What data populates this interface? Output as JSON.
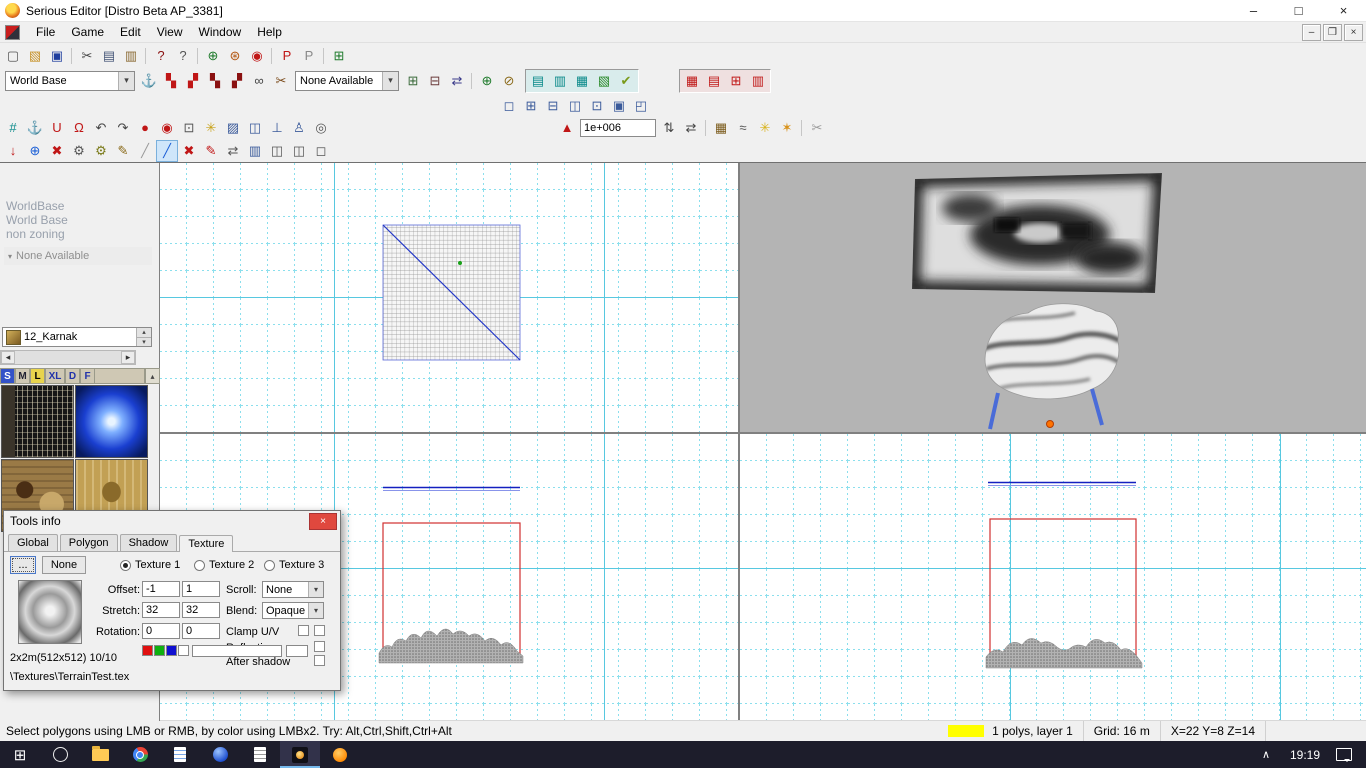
{
  "window": {
    "title": "Serious Editor [Distro Beta AP_3381]"
  },
  "glyphs": {
    "minimize": "–",
    "maximize": "□",
    "close": "×",
    "mdi_minimize": "–",
    "mdi_restore": "❐",
    "mdi_close": "×",
    "combo_arrow": "▾",
    "spin_up": "▴",
    "spin_down": "▾",
    "scroll_left": "◂",
    "scroll_right": "▸",
    "panel_collapse": "▴",
    "lp_chevron": "▾",
    "start": "⊞",
    "tray_chevron": "∧",
    "dialog_close": "×",
    "browse": "..."
  },
  "menu": {
    "items": [
      "File",
      "Game",
      "Edit",
      "View",
      "Window",
      "Help"
    ]
  },
  "toolbars": {
    "world_combo": "World Base",
    "none_combo": "None Available",
    "terrain_size_value": "1e+006",
    "row1": [
      {
        "n": "new-file-icon",
        "g": "▢",
        "c": "#555555"
      },
      {
        "n": "open-folder-icon",
        "g": "▧",
        "c": "#c8932a"
      },
      {
        "n": "save-icon",
        "g": "▣",
        "c": "#1f3e9e"
      },
      {
        "sep": true
      },
      {
        "n": "cut-icon",
        "g": "✂",
        "c": "#444444"
      },
      {
        "n": "copy-icon",
        "g": "▤",
        "c": "#445577"
      },
      {
        "n": "paste-icon",
        "g": "▥",
        "c": "#8a6a33"
      },
      {
        "sep": true
      },
      {
        "n": "help-icon",
        "g": "?",
        "c": "#8a1111"
      },
      {
        "n": "context-help-icon",
        "g": "?",
        "c": "#555555"
      },
      {
        "sep": true
      },
      {
        "n": "world-globe-icon",
        "g": "⊕",
        "c": "#1d7a2a"
      },
      {
        "n": "world-textures-icon",
        "g": "⊛",
        "c": "#b35712"
      },
      {
        "n": "world-red-icon",
        "g": "◉",
        "c": "#c01616"
      },
      {
        "sep": true
      },
      {
        "n": "p-red-icon",
        "g": "P",
        "c": "#c01616"
      },
      {
        "n": "p-gray-icon",
        "g": "P",
        "c": "#8a8a8a"
      },
      {
        "sep": true
      },
      {
        "n": "table-green-icon",
        "g": "⊞",
        "c": "#1d7a2a"
      }
    ],
    "row2_icons_a": [
      {
        "n": "anchor-icon",
        "g": "⚓",
        "c": "#1f3e9e"
      },
      {
        "n": "texture-stamp-1-icon",
        "g": "▚",
        "c": "#c01616"
      },
      {
        "n": "texture-stamp-2-icon",
        "g": "▞",
        "c": "#c01616"
      },
      {
        "n": "texture-stamp-3-icon",
        "g": "▚",
        "c": "#8a1111"
      },
      {
        "n": "texture-stamp-4-icon",
        "g": "▞",
        "c": "#8a1111"
      },
      {
        "n": "link-texture-icon",
        "g": "∞",
        "c": "#444444"
      },
      {
        "n": "unlink-texture-icon",
        "g": "✂",
        "c": "#7a4a1a"
      }
    ],
    "row2_icons_b": [
      {
        "n": "entity-add-icon",
        "g": "⊞",
        "c": "#3a6a3a"
      },
      {
        "n": "entity-remove-icon",
        "g": "⊟",
        "c": "#6a3a3a"
      },
      {
        "n": "entity-swap-icon",
        "g": "⇄",
        "c": "#3a3a8a"
      }
    ],
    "row2_icons_c": [
      {
        "n": "csg-add-icon",
        "g": "⊕",
        "c": "#1d7a2a"
      },
      {
        "n": "csg-split-icon",
        "g": "⊘",
        "c": "#8a6a1a"
      }
    ],
    "row2_group_teal": [
      {
        "n": "layer-primitive-icon",
        "g": "▤",
        "c": "#0a8a8a"
      },
      {
        "n": "layer-conus-icon",
        "g": "▥",
        "c": "#0a8a8a"
      },
      {
        "n": "layer-torus-icon",
        "g": "▦",
        "c": "#0a8a8a"
      },
      {
        "n": "layer-terrain-icon",
        "g": "▧",
        "c": "#2a8a2a"
      },
      {
        "n": "layer-check-icon",
        "g": "✔",
        "c": "#7a9a1a"
      }
    ],
    "row2_group_red": [
      {
        "n": "portal-icon",
        "g": "▦",
        "c": "#c01616"
      },
      {
        "n": "occluder-icon",
        "g": "▤",
        "c": "#c01616"
      },
      {
        "n": "detail-icon",
        "g": "⊞",
        "c": "#c01616"
      },
      {
        "n": "field-icon",
        "g": "▥",
        "c": "#c01616"
      }
    ],
    "row3": [
      {
        "n": "viewport-single-icon",
        "g": "◻",
        "c": "#3a5a9a"
      },
      {
        "n": "viewport-quad-icon",
        "g": "⊞",
        "c": "#3a5a9a"
      },
      {
        "n": "viewport-horiz-icon",
        "g": "⊟",
        "c": "#3a5a9a"
      },
      {
        "n": "viewport-vert-icon",
        "g": "◫",
        "c": "#3a5a9a"
      },
      {
        "n": "viewport-three-icon",
        "g": "⊡",
        "c": "#3a5a9a"
      },
      {
        "n": "viewport-custom-icon",
        "g": "▣",
        "c": "#3a5a9a"
      },
      {
        "n": "viewport-full-icon",
        "g": "◰",
        "c": "#3a5a9a"
      }
    ],
    "row4_left": [
      {
        "n": "grid-toggle-icon",
        "g": "#",
        "c": "#0a8a8a"
      },
      {
        "n": "snap-anchor-icon",
        "g": "⚓",
        "c": "#555555"
      },
      {
        "n": "magnet-u-icon",
        "g": "U",
        "c": "#c01616"
      },
      {
        "n": "magnet-o-icon",
        "g": "Ω",
        "c": "#c01616"
      },
      {
        "n": "rotate-left-icon",
        "g": "↶",
        "c": "#444444"
      },
      {
        "n": "rotate-right-icon",
        "g": "↷",
        "c": "#444444"
      },
      {
        "n": "marker-red-icon",
        "g": "●",
        "c": "#c01616"
      },
      {
        "n": "marker-ring-icon",
        "g": "◉",
        "c": "#c01616"
      },
      {
        "n": "select-box-icon",
        "g": "⊡",
        "c": "#555555"
      },
      {
        "n": "light-icon",
        "g": "✳",
        "c": "#c8a21a"
      },
      {
        "n": "picture-icon",
        "g": "▨",
        "c": "#3a5a9a"
      },
      {
        "n": "window-icon",
        "g": "◫",
        "c": "#3a5a9a"
      },
      {
        "n": "ruler-icon",
        "g": "⊥",
        "c": "#3a5a9a"
      },
      {
        "n": "person-icon",
        "g": "♙",
        "c": "#3a5a9a"
      },
      {
        "n": "target-icon",
        "g": "◎",
        "c": "#555555"
      }
    ],
    "row4_mid_pre": [
      {
        "n": "terrain-brush-icon",
        "g": "▲",
        "c": "#c01616"
      }
    ],
    "row4_mid_spin": [
      {
        "n": "spin-up-down-icon",
        "g": "⇅",
        "c": "#444444"
      },
      {
        "n": "spin-swap-icon",
        "g": "⇄",
        "c": "#444444"
      }
    ],
    "row4_mid_post": [
      {
        "n": "terrain-edit-icon",
        "g": "▦",
        "c": "#7a5a1a"
      },
      {
        "n": "terrain-smooth-icon",
        "g": "≈",
        "c": "#555555"
      },
      {
        "n": "sun-icon",
        "g": "✳",
        "c": "#d8b21a"
      },
      {
        "n": "sun-alt-icon",
        "g": "✶",
        "c": "#d8921a"
      },
      {
        "sep": true
      },
      {
        "n": "cut-terrain-icon",
        "g": "✂",
        "c": "#9a9a9a"
      }
    ],
    "row5": [
      {
        "n": "drop-marker-icon",
        "g": "↓",
        "c": "#c01616"
      },
      {
        "n": "world-wire-icon",
        "g": "⊕",
        "c": "#1a5ed6"
      },
      {
        "n": "crush-icon",
        "g": "✖",
        "c": "#c01616"
      },
      {
        "n": "gears-icon",
        "g": "⚙",
        "c": "#555555"
      },
      {
        "n": "gear-add-icon",
        "g": "⚙",
        "c": "#7a7a1a"
      },
      {
        "n": "script-icon",
        "g": "✎",
        "c": "#8a6a1a"
      },
      {
        "n": "pencil-gray-icon",
        "g": "╱",
        "c": "#9a9a9a"
      },
      {
        "n": "pencil-active-icon",
        "g": "╱",
        "c": "#1a5ed6",
        "bg": "#cfe6fa",
        "bd": "#7ab0dc"
      },
      {
        "n": "erase-icon",
        "g": "✖",
        "c": "#c01616"
      },
      {
        "n": "brush-icon",
        "g": "✎",
        "c": "#c01616"
      },
      {
        "n": "flip-icon",
        "g": "⇄",
        "c": "#555555"
      },
      {
        "n": "book-icon",
        "g": "▥",
        "c": "#3a5a9a"
      },
      {
        "n": "copy-frame-icon",
        "g": "◫",
        "c": "#555555"
      },
      {
        "n": "frame-2-icon",
        "g": "◫",
        "c": "#555555"
      },
      {
        "n": "frame-3-icon",
        "g": "◻",
        "c": "#555555"
      }
    ]
  },
  "left_panel": {
    "labels": [
      "WorldBase",
      "World Base",
      "non zoning"
    ],
    "none_available": "None Available",
    "texture_set": "12_Karnak",
    "size_tabs": [
      "S",
      "M",
      "L",
      "XL",
      "D",
      "F"
    ]
  },
  "tools_info": {
    "title": "Tools info",
    "tabs": [
      "Global",
      "Polygon",
      "Shadow",
      "Texture"
    ],
    "active_tab": "Texture",
    "none_label": "None",
    "radios": [
      "Texture 1",
      "Texture 2",
      "Texture 3"
    ],
    "selected_radio": "Texture 1",
    "fields": {
      "offset_label": "Offset:",
      "offset_u": "-1",
      "offset_v": "1",
      "stretch_label": "Stretch:",
      "stretch_u": "32",
      "stretch_v": "32",
      "rotation_label": "Rotation:",
      "rotation_u": "0",
      "rotation_v": "0",
      "scroll_label": "Scroll:",
      "scroll_value": "None",
      "blend_label": "Blend:",
      "blend_value": "Opaque",
      "clamp_label": "Clamp U/V",
      "reflective_label": "Reflective",
      "after_shadow_label": "After shadow"
    },
    "texture_info": "2x2m(512x512) 10/10",
    "texture_path": "\\Textures\\TerrainTest.tex",
    "swatch_colors": [
      "#e01010",
      "#10b010",
      "#1010d0",
      "#ffffff"
    ]
  },
  "status_bar": {
    "message": "Select polygons using LMB or RMB, by color using LMBx2. Try: Alt,Ctrl,Shift,Ctrl+Alt",
    "polys": "1 polys, layer 1",
    "grid": "Grid: 16 m",
    "coords": "X=22 Y=8 Z=14"
  },
  "taskbar": {
    "time": "19:19"
  }
}
